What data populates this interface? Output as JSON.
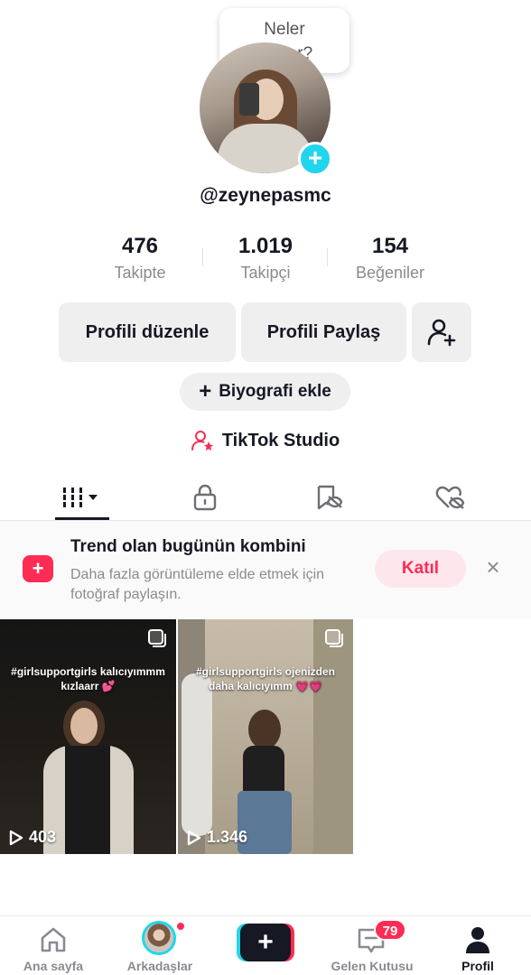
{
  "profile": {
    "bubble_text_line1": "Neler",
    "bubble_text_line2": "oluyor?",
    "username": "@zeynepasmc"
  },
  "stats": [
    {
      "value": "476",
      "label": "Takipte"
    },
    {
      "value": "1.019",
      "label": "Takipçi"
    },
    {
      "value": "154",
      "label": "Beğeniler"
    }
  ],
  "actions": {
    "edit_profile": "Profili düzenle",
    "share_profile": "Profili Paylaş",
    "add_bio": "Biyografi ekle",
    "add_bio_plus": "+",
    "studio": "TikTok Studio"
  },
  "tabs": [
    {
      "icon": "grid-icon",
      "active": true
    },
    {
      "icon": "lock-icon",
      "active": false
    },
    {
      "icon": "bookmark-icon",
      "active": false
    },
    {
      "icon": "heart-icon",
      "active": false
    }
  ],
  "trend": {
    "title": "Trend olan bugünün kombini",
    "subtitle": "Daha fazla görüntüleme elde etmek için fotoğraf paylaşın.",
    "join": "Katıl",
    "close": "×"
  },
  "videos": [
    {
      "caption": "#girlsupportgirls kalıcıyımmm kızlaarr 💕",
      "views": "403"
    },
    {
      "caption": "#girlsupportgirls ojenizden daha kalıcıyımm 💗💗",
      "views": "1.346"
    }
  ],
  "nav": {
    "home": "Ana sayfa",
    "friends": "Arkadaşlar",
    "create": "+",
    "inbox": "Gelen Kutusu",
    "inbox_badge": "79",
    "profile": "Profil"
  },
  "colors": {
    "accent_pink": "#fe2c55",
    "accent_cyan": "#20d5ec",
    "text": "#161823",
    "muted": "#8a8b91"
  }
}
